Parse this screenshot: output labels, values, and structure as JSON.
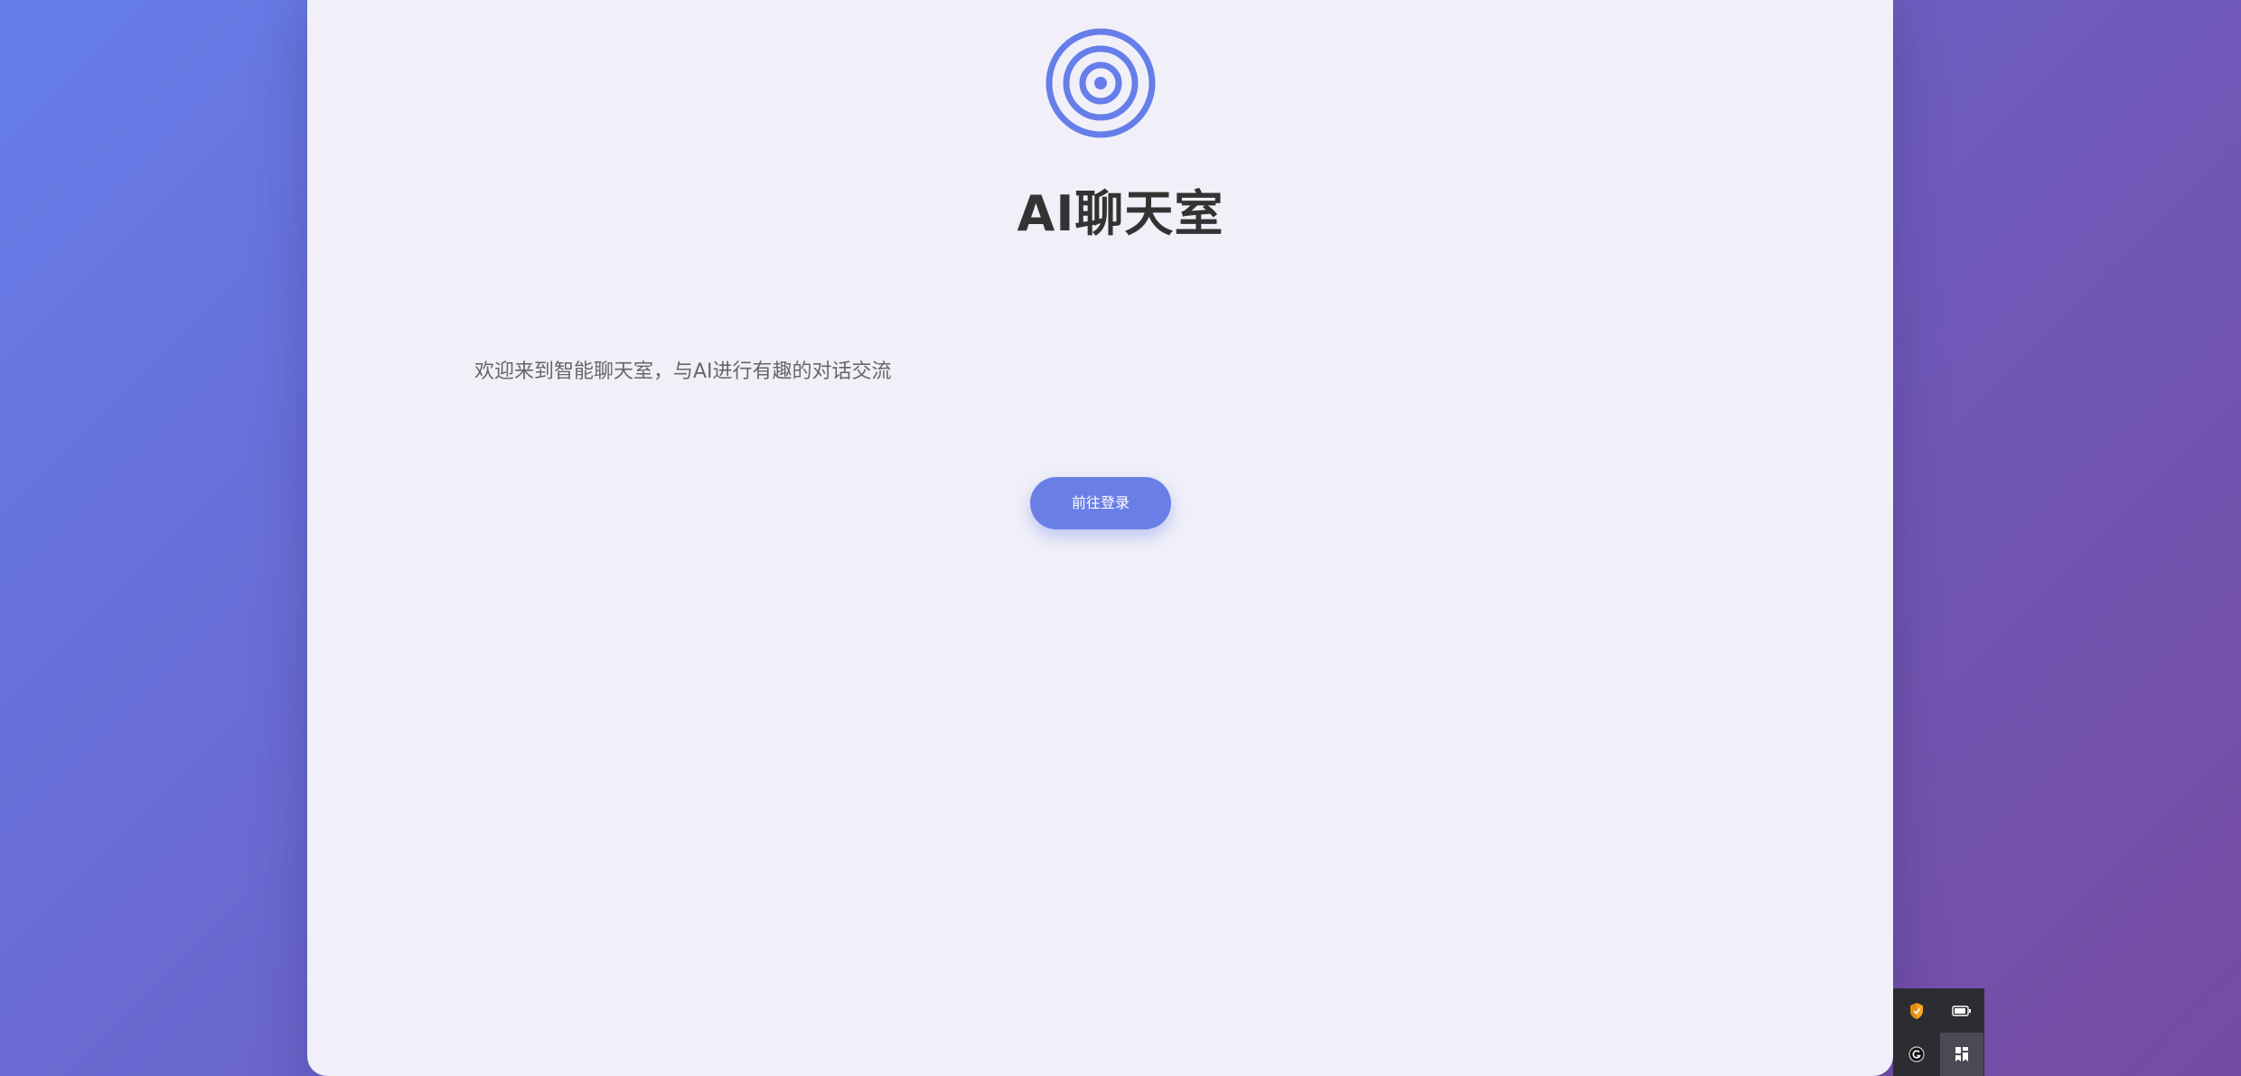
{
  "app": {
    "title": "AI聊天室",
    "subtitle": "欢迎来到智能聊天室，与AI进行有趣的对话交流",
    "logo_icon": "target-icon",
    "accent_color": "#667eea"
  },
  "actions": {
    "login_label": "前往登录"
  },
  "tray": {
    "icons": [
      "shield-icon",
      "battery-icon",
      "app-g-icon",
      "bookmark-icon"
    ]
  }
}
